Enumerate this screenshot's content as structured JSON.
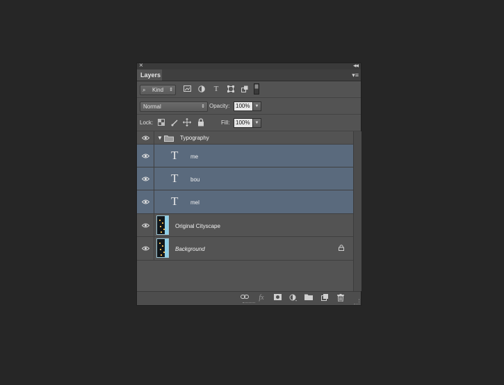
{
  "panel": {
    "close_glyph": "×",
    "collapse_glyph": "◂◂",
    "tab_label": "Layers",
    "menu_glyph": "▾≡"
  },
  "filter": {
    "kind_label": "Kind",
    "icons": [
      "image-filter-icon",
      "adjustment-filter-icon",
      "type-filter-icon",
      "shape-filter-icon",
      "smart-object-filter-icon",
      "filter-toggle-icon"
    ]
  },
  "blend": {
    "mode": "Normal",
    "opacity_label": "Opacity:",
    "opacity_value": "100%"
  },
  "lock": {
    "label": "Lock:",
    "fill_label": "Fill:",
    "fill_value": "100%"
  },
  "layers": [
    {
      "name": "Typography",
      "type": "group",
      "selected": false
    },
    {
      "name": "me",
      "type": "text",
      "selected": true
    },
    {
      "name": "bou",
      "type": "text",
      "selected": true
    },
    {
      "name": "mel",
      "type": "text",
      "selected": true
    },
    {
      "name": "Original Cityscape",
      "type": "image",
      "selected": false
    },
    {
      "name": "Background",
      "type": "image",
      "selected": false,
      "locked": true
    }
  ],
  "text_glyph": "T",
  "bottom_icons": [
    "link-layers-icon",
    "fx-icon",
    "add-mask-icon",
    "adjustment-layer-icon",
    "new-group-icon",
    "new-layer-icon",
    "trash-icon"
  ],
  "fx_label": "fx",
  "colors": {
    "panel_bg": "#535353",
    "selected_row": "#5a6a7d",
    "app_bg": "#262626"
  }
}
